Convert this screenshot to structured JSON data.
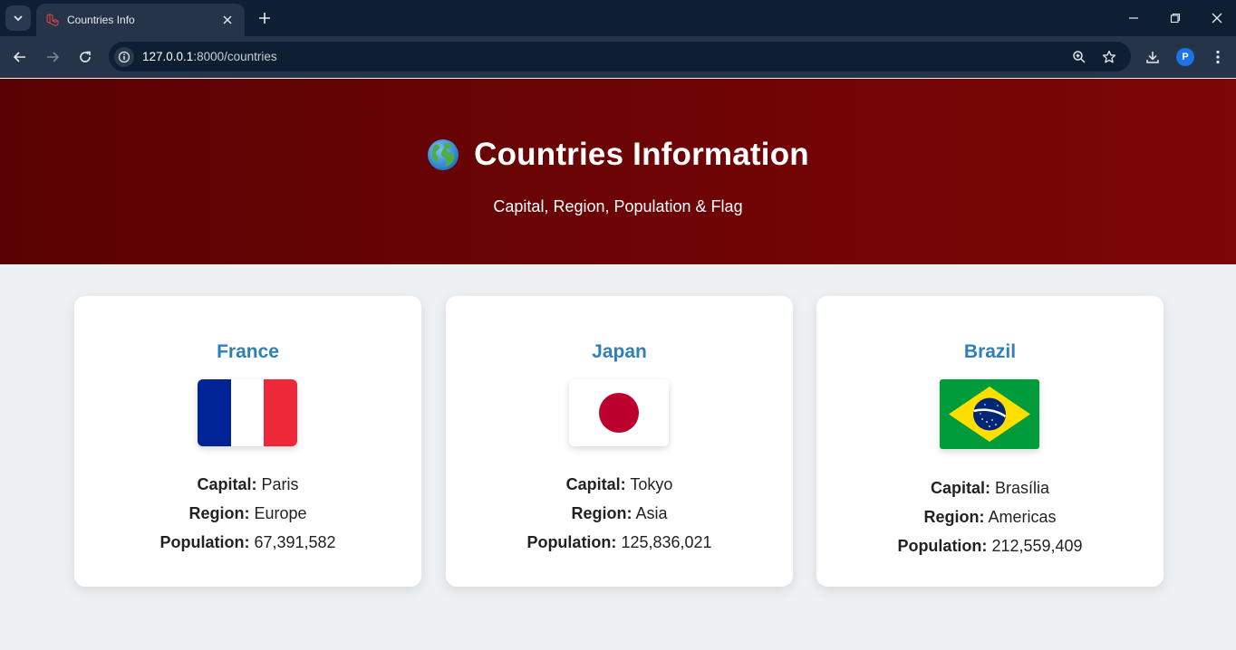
{
  "browser": {
    "tab_title": "Countries Info",
    "url_host": "127.0.0.1",
    "url_rest": ":8000/countries",
    "profile_initial": "P"
  },
  "page": {
    "title": "Countries Information",
    "subtitle": "Capital, Region, Population & Flag"
  },
  "labels": {
    "capital": "Capital:",
    "region": "Region:",
    "population": "Population:"
  },
  "countries": [
    {
      "name": "France",
      "capital": "Paris",
      "region": "Europe",
      "population": "67,391,582"
    },
    {
      "name": "Japan",
      "capital": "Tokyo",
      "region": "Asia",
      "population": "125,836,021"
    },
    {
      "name": "Brazil",
      "capital": "Brasília",
      "region": "Americas",
      "population": "212,559,409"
    }
  ],
  "colors": {
    "hero_bg": "#6e0405",
    "country_name": "#2f7fb8",
    "page_bg": "#eef1f3"
  }
}
